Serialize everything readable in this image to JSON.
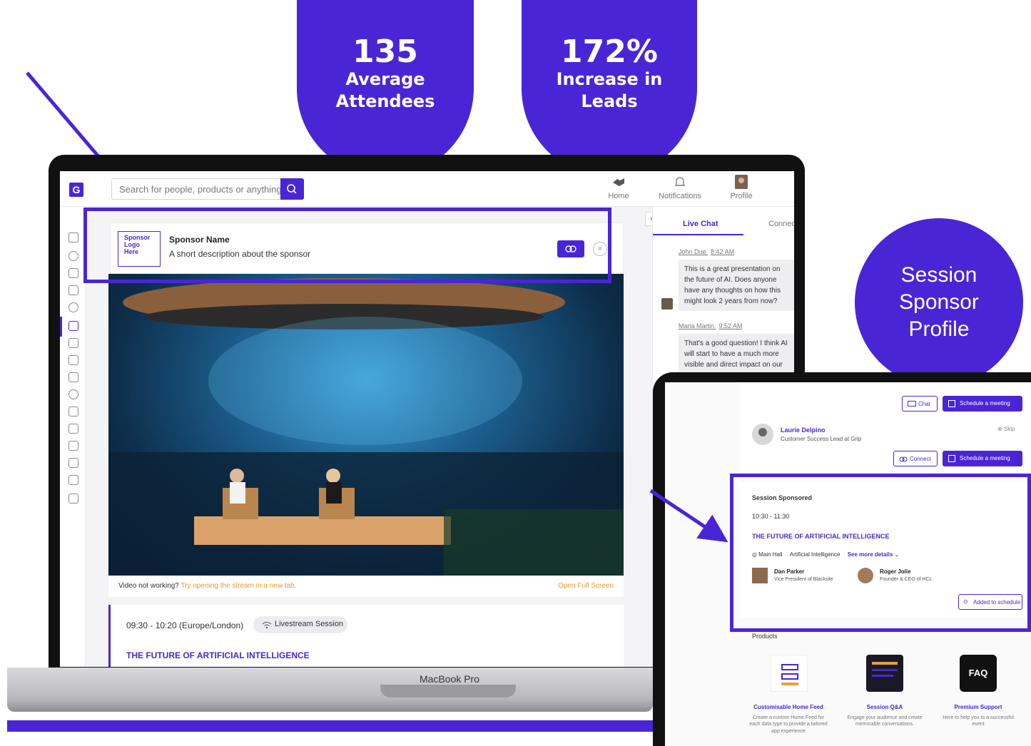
{
  "stats": [
    {
      "value": "135",
      "label_line1": "Average",
      "label_line2": "Attendees"
    },
    {
      "value": "172%",
      "label_line1": "Increase in",
      "label_line2": "Leads"
    }
  ],
  "callout": {
    "line1": "Session",
    "line2": "Sponsor",
    "line3": "Profile"
  },
  "colors": {
    "brand": "#4a25d6",
    "accent_link": "#e89b2b"
  },
  "laptop": {
    "brand_label": "MacBook Pro",
    "app_logo": "G",
    "search_placeholder": "Search for people, products or anything?",
    "nav": [
      {
        "label": "Home",
        "icon": "handshake-icon"
      },
      {
        "label": "Notifications",
        "icon": "bell-icon"
      },
      {
        "label": "Profile",
        "icon": "avatar"
      }
    ],
    "sponsor": {
      "logo_line1": "Sponsor",
      "logo_line2": "Logo",
      "logo_line3": "Here",
      "name": "Sponsor Name",
      "description": "A short description about the sponsor"
    },
    "video": {
      "not_working": "Video not working?",
      "open_stream": "Try opening the stream in a new tab.",
      "full_screen": "Open Full Screen"
    },
    "session": {
      "time": "09:30 - 10:20 (Europe/London)",
      "badge": "Livestream Session",
      "title": "THE FUTURE OF ARTIFICIAL INTELLIGENCE"
    },
    "chat": {
      "tabs": [
        "Live Chat",
        "Connec"
      ],
      "messages": [
        {
          "author": "John Due",
          "time": "8:42 AM",
          "text": "This is a great presentation on the future of AI. Does anyone have any thoughts on how this might look 2 years from now?"
        },
        {
          "author": "Maria Martin",
          "time": "9:52 AM",
          "text": "That's a good question! I think AI will start to have a much more visible and direct impact on our"
        }
      ]
    }
  },
  "profile": {
    "chat_label": "Chat",
    "schedule_label": "Schedule a meeting",
    "person": {
      "name": "Laurie Delpino",
      "role": "Customer Success Lead at Grip",
      "skip": "Skip"
    },
    "connect_label": "Connect",
    "sponsored": {
      "heading": "Session Sponsored",
      "time": "10:30 - 11:30",
      "title": "THE FUTURE OF ARTIFICIAL INTELLIGENCE",
      "location": "Main Hall",
      "topic": "Artificial Intelligence",
      "see_more": "See more details",
      "speakers": [
        {
          "name": "Dan Parker",
          "role": "Vice President of Blacksite"
        },
        {
          "name": "Roger Jolie",
          "role": "Founder & CEO of HCL"
        }
      ],
      "added": "Added to schedule"
    },
    "products_heading": "Products",
    "products": [
      {
        "name": "Customisable Home Feed",
        "desc": "Create a custom Home Feed for each data type to provide a tailored app experience"
      },
      {
        "name": "Session Q&A",
        "desc": "Engage your audience and create memorable conversations."
      },
      {
        "name": "Premium Support",
        "desc": "Here to help you to a successful event",
        "icon_text": "FAQ"
      }
    ]
  }
}
